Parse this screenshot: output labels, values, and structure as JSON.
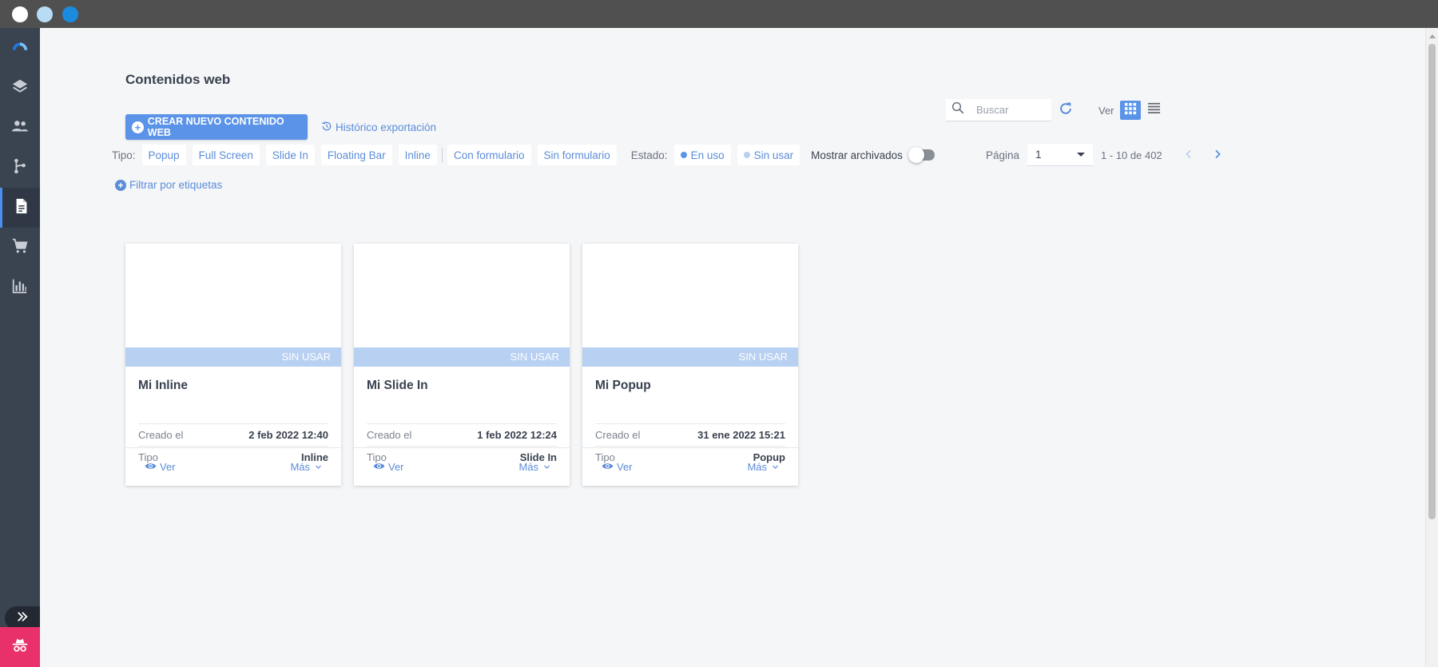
{
  "colors": {
    "accent": "#5b93e8",
    "sidebar": "#3a4350",
    "status_bar": "#b8d0f2",
    "spy_button": "#e8306a",
    "chrome": "#505050"
  },
  "sidebar": {
    "items": [
      {
        "icon": "logo-arc-icon"
      },
      {
        "icon": "layers-icon"
      },
      {
        "icon": "contacts-icon"
      },
      {
        "icon": "automation-icon"
      },
      {
        "icon": "document-icon",
        "active": true
      },
      {
        "icon": "cart-icon"
      },
      {
        "icon": "bar-chart-icon"
      }
    ],
    "expand_icon": "double-chevron-right-icon",
    "bottom_icon": "incognito-icon"
  },
  "header": {
    "title": "Contenidos web",
    "create_button": "CREAR NUEVO CONTENIDO WEB",
    "history_link": "Histórico exportación",
    "search_placeholder": "Buscar",
    "view_label": "Ver"
  },
  "filters": {
    "type_label": "Tipo:",
    "types": [
      "Popup",
      "Full Screen",
      "Slide In",
      "Floating Bar",
      "Inline"
    ],
    "forms": [
      "Con formulario",
      "Sin formulario"
    ],
    "state_label": "Estado:",
    "states": [
      {
        "label": "En uso",
        "color": "#5b93e8"
      },
      {
        "label": "Sin usar",
        "color": "#b8d0f2"
      }
    ],
    "archived_label": "Mostrar archivados",
    "archived_on": false,
    "tag_filter": "Filtrar por etiquetas"
  },
  "pagination": {
    "label": "Página",
    "current": "1",
    "range": "1 - 10 de 402"
  },
  "cards": [
    {
      "status": "SIN USAR",
      "title": "Mi Inline",
      "created_label": "Creado el",
      "created": "2 feb 2022 12:40",
      "type_label": "Tipo",
      "type": "Inline",
      "view": "Ver",
      "more": "Más"
    },
    {
      "status": "SIN USAR",
      "title": "Mi Slide In",
      "created_label": "Creado el",
      "created": "1 feb 2022 12:24",
      "type_label": "Tipo",
      "type": "Slide In",
      "view": "Ver",
      "more": "Más"
    },
    {
      "status": "SIN USAR",
      "title": "Mi Popup",
      "created_label": "Creado el",
      "created": "31 ene 2022 15:21",
      "type_label": "Tipo",
      "type": "Popup",
      "view": "Ver",
      "more": "Más"
    }
  ]
}
